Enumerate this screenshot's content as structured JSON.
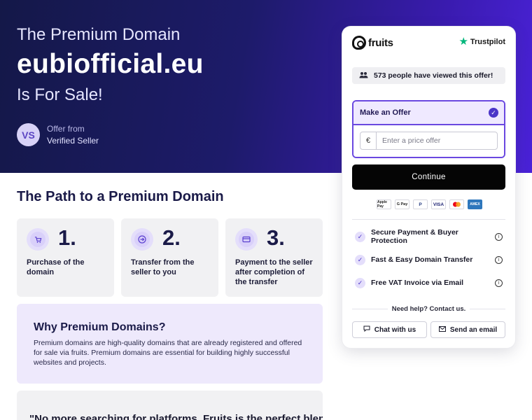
{
  "hero": {
    "pre_title": "The Premium Domain",
    "domain": "eubiofficial.eu",
    "post_title": "Is For Sale!",
    "seller_initials": "VS",
    "offer_from": "Offer from",
    "seller_name": "Verified Seller"
  },
  "path": {
    "title": "The Path to a Premium Domain",
    "steps": [
      {
        "number": "1.",
        "text": "Purchase of the domain",
        "icon": "cart-icon"
      },
      {
        "number": "2.",
        "text": "Transfer from the seller to you",
        "icon": "arrow-right-circle-icon"
      },
      {
        "number": "3.",
        "text": "Payment to the seller after completion of the transfer",
        "icon": "card-icon"
      }
    ]
  },
  "why": {
    "title": "Why Premium Domains?",
    "body": "Premium domains are high-quality domains that are already registered and offered for sale via fruits. Premium domains are essential for building highly successful websites and projects."
  },
  "quote": {
    "text": "\"No more searching for platforms. Fruits is the perfect blend"
  },
  "card": {
    "brand": "fruits",
    "trustpilot": "Trustpilot",
    "viewed": "573 people have viewed this offer!",
    "offer_label": "Make an Offer",
    "currency": "€",
    "price_placeholder": "Enter a price offer",
    "continue_label": "Continue",
    "payments": [
      "Apple Pay",
      "G Pay",
      "P",
      "VISA",
      "MC",
      "AMEX"
    ],
    "features": [
      "Secure Payment & Buyer Protection",
      "Fast & Easy Domain Transfer",
      "Free VAT Invoice via Email"
    ],
    "help": "Need help? Contact us.",
    "chat_label": "Chat with us",
    "email_label": "Send an email"
  },
  "colors": {
    "accent": "#4b35c8",
    "hero_start": "#141848",
    "hero_end": "#4a22d8",
    "trustpilot_star": "#00b67a"
  }
}
